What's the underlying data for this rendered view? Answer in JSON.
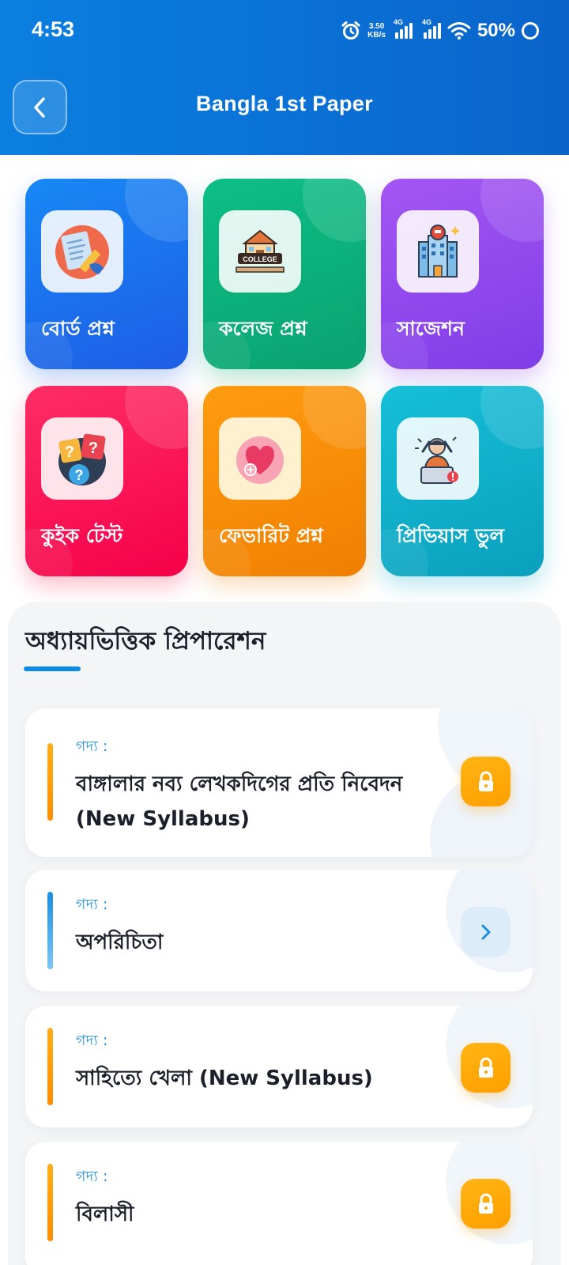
{
  "status_bar": {
    "time": "4:53",
    "speed_value": "3.50",
    "speed_unit": "KB/s",
    "network_1": "4G",
    "network_2": "4G",
    "battery": "50%"
  },
  "header": {
    "title": "Bangla 1st Paper",
    "back_icon": "chevron-left-icon",
    "background_color": "#0a6fd4"
  },
  "tiles": [
    {
      "label": "বোর্ড প্রশ্ন",
      "icon": "exam-paper-icon",
      "color": "#1e6ee8"
    },
    {
      "label": "কলেজ প্রশ্ন",
      "icon": "college-building-icon",
      "color": "#0aae78"
    },
    {
      "label": "সাজেশন",
      "icon": "school-building-icon",
      "color": "#8f48ee"
    },
    {
      "label": "কুইক টেস্ট",
      "icon": "question-marks-icon",
      "color": "#fa1556"
    },
    {
      "label": "ফেভারিট প্রশ্ন",
      "icon": "heart-icon",
      "color": "#f88a05"
    },
    {
      "label": "প্রিভিয়াস ভুল",
      "icon": "stressed-person-icon",
      "color": "#10afca"
    }
  ],
  "chapters_section": {
    "title": "অধ্যায়ভিত্তিক প্রিপারেশন",
    "items": [
      {
        "category": "গদ্য :",
        "title": "বাঙ্গালার নব্য লেখকদিগের প্রতি নিবেদন (New Syllabus)",
        "state": "locked",
        "accent": "#ff9800"
      },
      {
        "category": "গদ্য :",
        "title": "অপরিচিতা",
        "state": "open",
        "accent": "#1a8fe0"
      },
      {
        "category": "গদ্য :",
        "title": "সাহিত্যে খেলা (New Syllabus)",
        "state": "locked",
        "accent": "#ff9800"
      },
      {
        "category": "গদ্য :",
        "title": "বিলাসী",
        "state": "locked",
        "accent": "#ff9800"
      }
    ]
  }
}
